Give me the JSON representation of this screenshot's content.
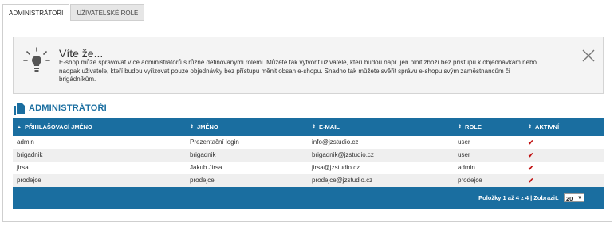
{
  "tabs": [
    {
      "label": "ADMINISTRÁTOŘI",
      "active": true
    },
    {
      "label": "UŽIVATELSKÉ ROLE",
      "active": false
    }
  ],
  "info": {
    "title": "Víte že...",
    "text": "E-shop může spravovat více administrátorů s různě definovanými rolemi. Můžete tak vytvořit uživatele, kteří budou např. jen plnit zboží bez přístupu k objednávkám nebo naopak uživatele, kteří budou vyřizovat pouze objednávky bez přístupu měnit obsah e-shopu. Snadno tak můžete svěřit správu e-shopu svým zaměstnancům či brigádníkům."
  },
  "section": {
    "title": "ADMINISTRÁTOŘI"
  },
  "table": {
    "columns": [
      "PŘIHLAŠOVACÍ JMÉNO",
      "JMÉNO",
      "E-MAIL",
      "ROLE",
      "AKTIVNÍ"
    ],
    "rows": [
      {
        "login": "admin",
        "name": "Prezentační login",
        "email": "info@jzstudio.cz",
        "role": "user",
        "active": "✔"
      },
      {
        "login": "brigadnik",
        "name": "brigadnik",
        "email": "brigadnik@jzstudio.cz",
        "role": "user",
        "active": "✔"
      },
      {
        "login": "jirsa",
        "name": "Jakub Jirsa",
        "email": "jirsa@jzstudio.cz",
        "role": "admin",
        "active": "✔"
      },
      {
        "login": "prodejce",
        "name": "prodejce",
        "email": "prodejce@jzstudio.cz",
        "role": "prodejce",
        "active": "✔"
      }
    ],
    "footer": {
      "pager": "Položky 1 až 4 z 4 | Zobrazit:",
      "page_size": "20"
    }
  },
  "colors": {
    "accent": "#1a6ea0",
    "check": "#c01010"
  },
  "icons": {
    "info": "lightbulb-icon",
    "close": "close-icon",
    "section": "document-icon",
    "sort": "sort-icon"
  }
}
